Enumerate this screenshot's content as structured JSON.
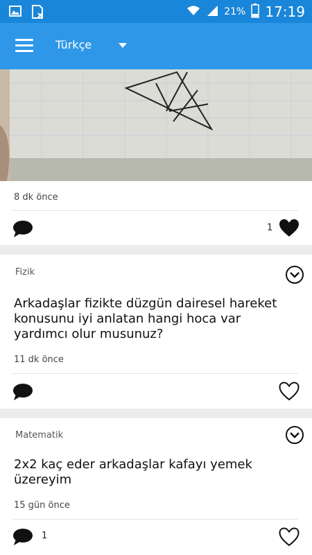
{
  "status_bar": {
    "battery": "21%",
    "time": "17:19",
    "icons": [
      "image-icon",
      "sim-icon",
      "wifi-icon",
      "signal-icon",
      "battery-icon"
    ]
  },
  "app_bar": {
    "language": "Türkçe",
    "icons": [
      "menu-icon",
      "dropdown-caret-icon"
    ]
  },
  "posts": [
    {
      "has_image": true,
      "time": "8 dk önce",
      "likes": "1",
      "liked": true
    },
    {
      "subject": "Fizik",
      "question": "Arkadaşlar fizikte düzgün dairesel hareket konusunu iyi anlatan hangi hoca var yardımcı olur musunuz?",
      "time": "11 dk önce",
      "liked": false
    },
    {
      "subject": "Matematik",
      "question": "2x2 kaç eder arkadaşlar kafayı yemek üzereyim",
      "time": "15 gün önce",
      "comments": "1",
      "liked": false
    }
  ],
  "colors": {
    "status_bar": "#1a86d9",
    "app_bar": "#2f97e8",
    "background": "#ececec"
  }
}
